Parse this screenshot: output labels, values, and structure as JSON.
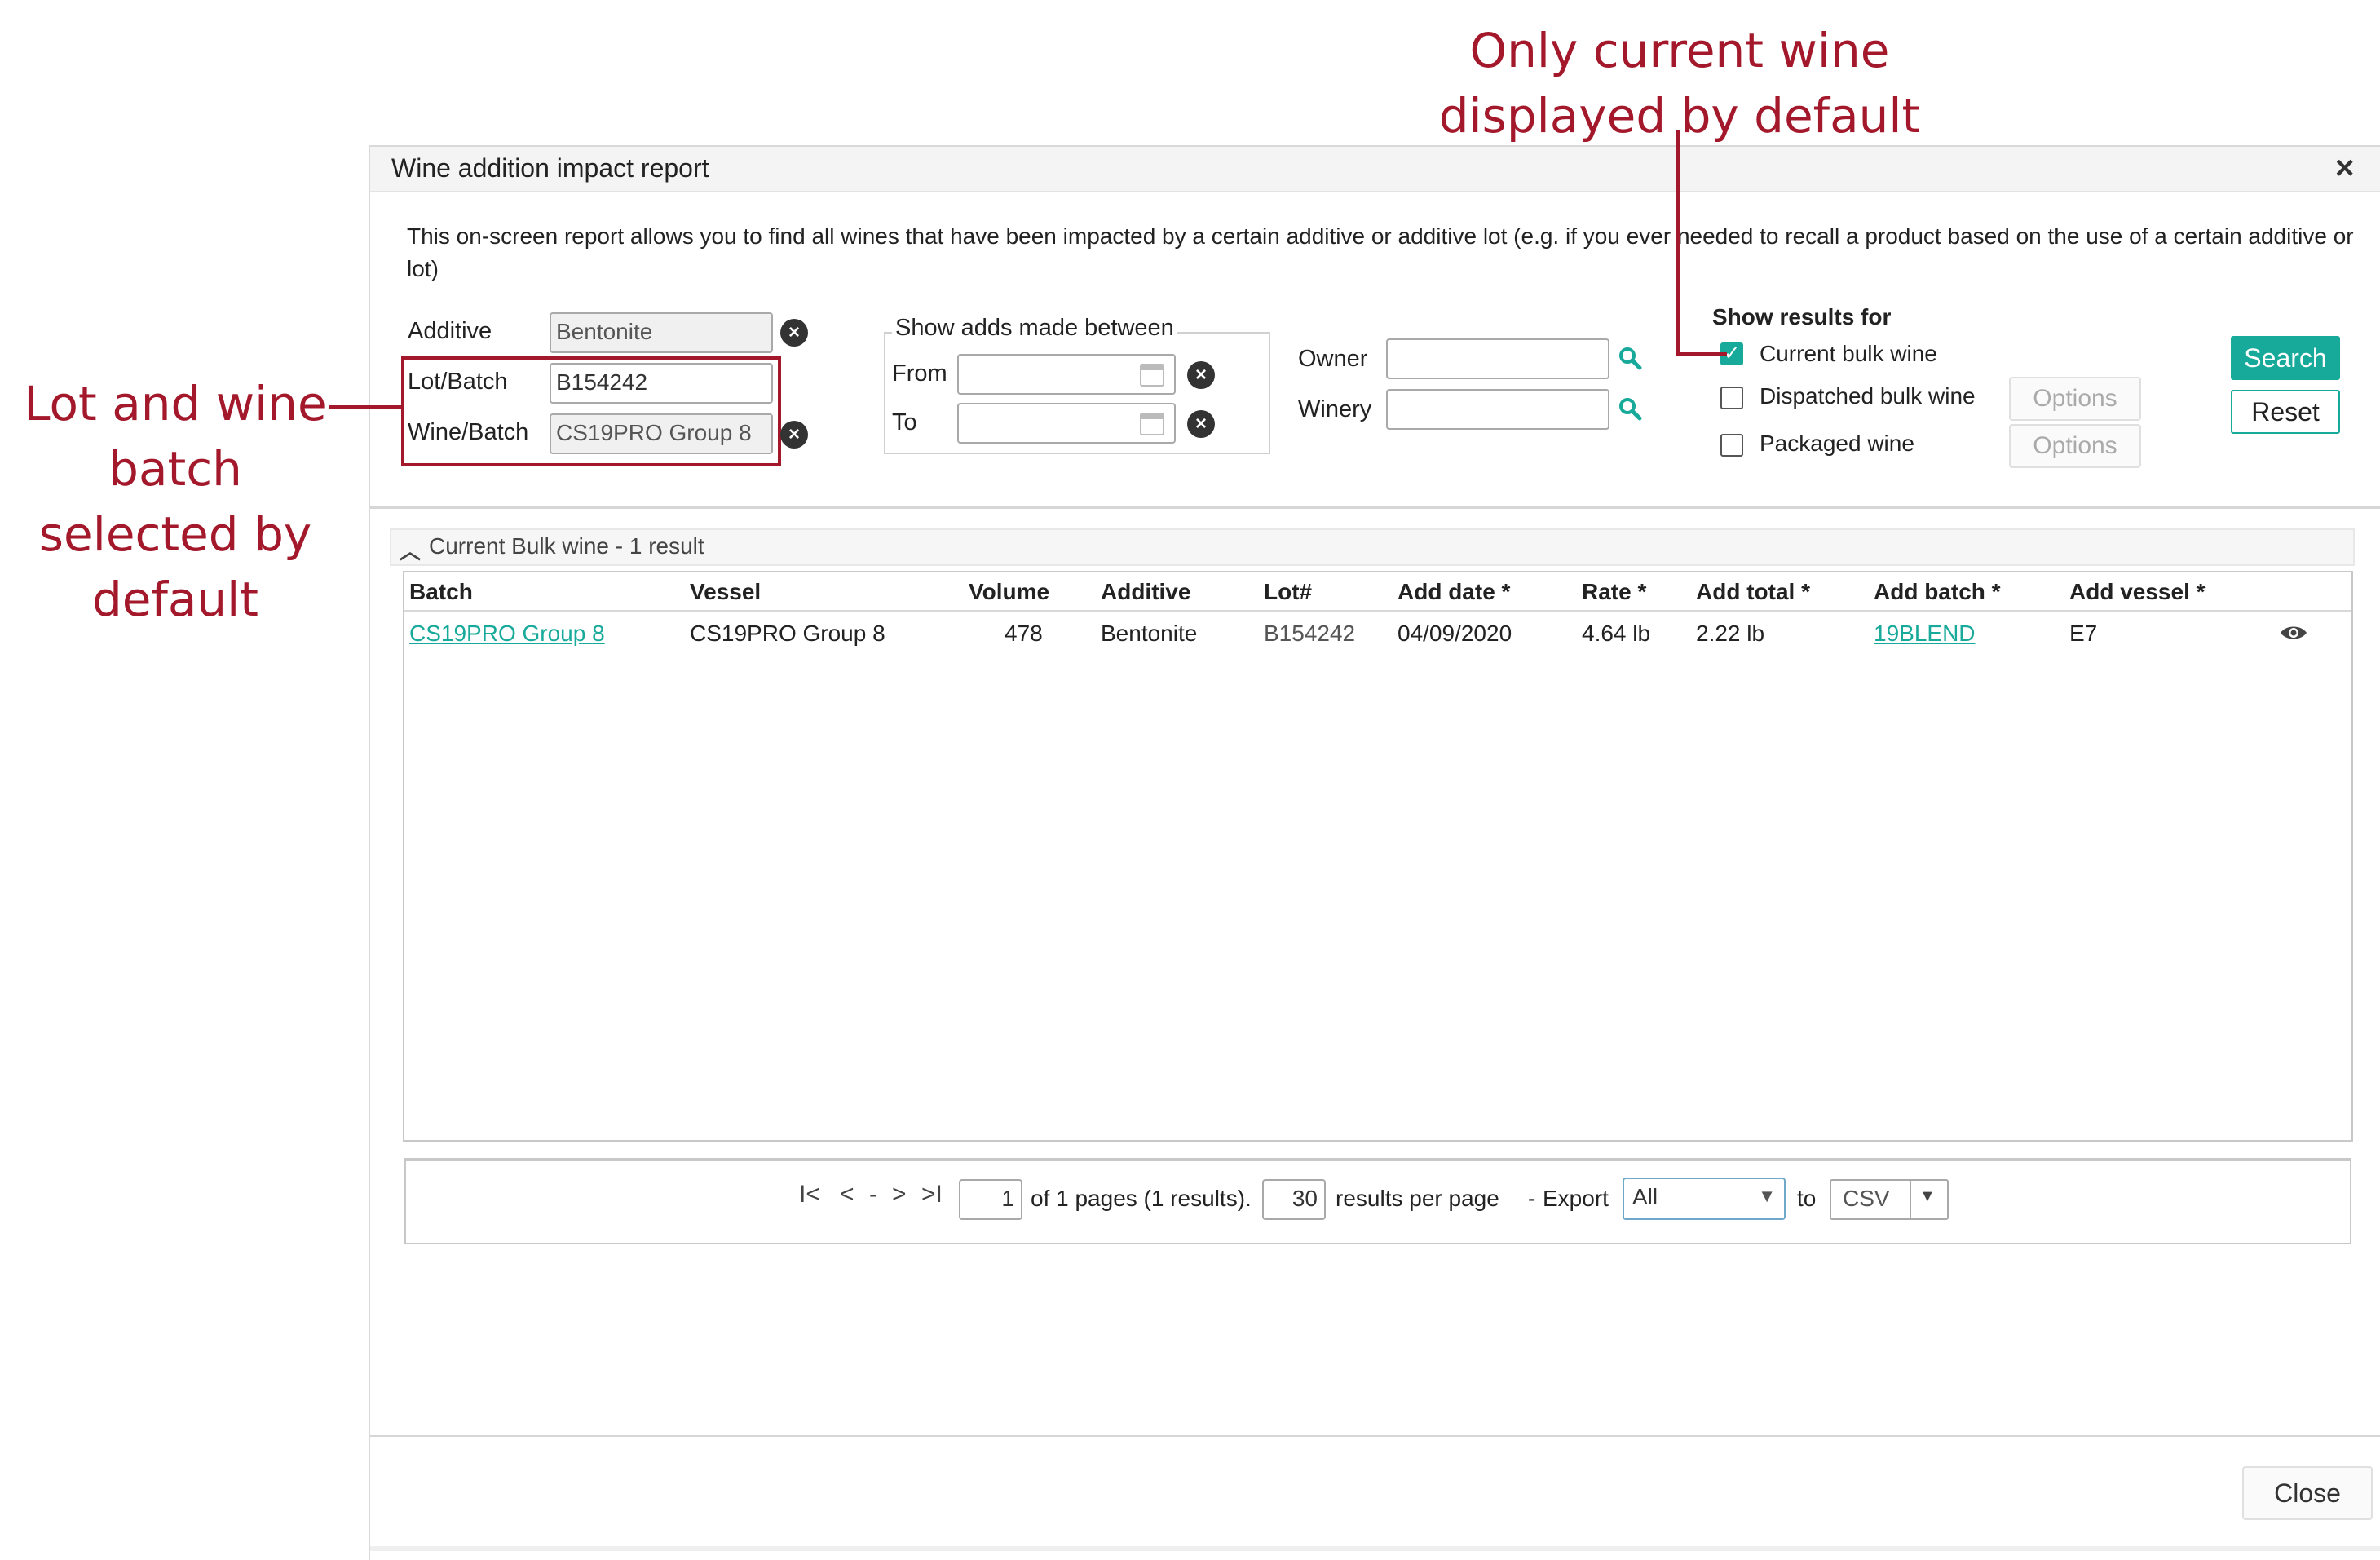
{
  "annotations": {
    "top_line1": "Only current wine",
    "top_line2": "displayed by default",
    "left_line1": "Lot and wine",
    "left_line2": "batch",
    "left_line3": "selected by",
    "left_line4": "default"
  },
  "dialog": {
    "title": "Wine addition impact report",
    "close_glyph": "×",
    "description": "This on-screen report allows you to find all wines that have been impacted by a certain additive or additive lot (e.g. if you ever needed to recall a product based on the use of a certain additive or lot)"
  },
  "filters": {
    "additive_label": "Additive",
    "additive_value": "Bentonite",
    "lot_label": "Lot/Batch",
    "lot_value": "B154242",
    "wine_label": "Wine/Batch",
    "wine_value": "CS19PRO Group 8",
    "daterange_legend": "Show adds made between",
    "from_label": "From",
    "to_label": "To",
    "from_value": "",
    "to_value": "",
    "owner_label": "Owner",
    "owner_value": "",
    "winery_label": "Winery",
    "winery_value": ""
  },
  "show_results": {
    "heading": "Show results for",
    "options": [
      {
        "label": "Current bulk wine",
        "checked": true
      },
      {
        "label": "Dispatched bulk wine",
        "checked": false,
        "button": "Options"
      },
      {
        "label": "Packaged wine",
        "checked": false,
        "button": "Options"
      }
    ]
  },
  "actions": {
    "search": "Search",
    "reset": "Reset",
    "close": "Close"
  },
  "results": {
    "section_title": "Current Bulk wine - 1 result",
    "columns": [
      "Batch",
      "Vessel",
      "Volume",
      "Additive",
      "Lot#",
      "Add date *",
      "Rate *",
      "Add total *",
      "Add batch *",
      "Add vessel *"
    ],
    "rows": [
      {
        "batch": "CS19PRO Group 8",
        "vessel": "CS19PRO Group 8",
        "volume": "478",
        "additive": "Bentonite",
        "lot": "B154242",
        "add_date": "04/09/2020",
        "rate": "4.64 lb",
        "add_total": "2.22 lb",
        "add_batch": "19BLEND",
        "add_vessel": "E7"
      }
    ]
  },
  "pager": {
    "first": "I<",
    "prev": "<",
    "dash": "-",
    "next": ">",
    "last": ">I",
    "page_value": "1",
    "of_pages_text": "of 1 pages (1 results).",
    "per_page_value": "30",
    "per_page_text": "results per page",
    "export_sep": "-",
    "export_label": "Export",
    "export_value": "All",
    "to_label": "to",
    "format_value": "CSV"
  },
  "colors": {
    "accent": "#17a99a",
    "annotation": "#a3192b"
  }
}
